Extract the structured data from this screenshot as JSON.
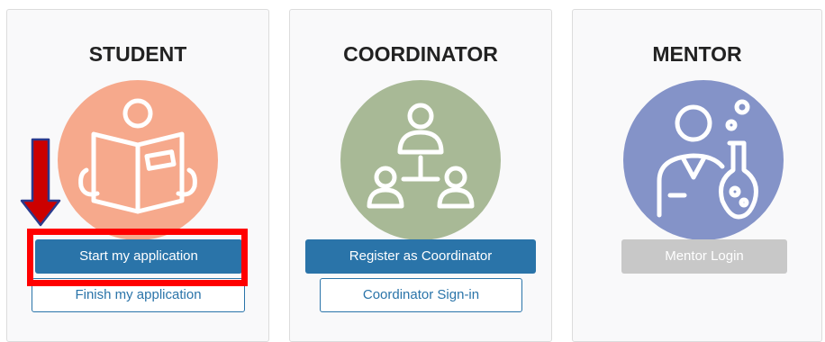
{
  "student": {
    "title": "STUDENT",
    "icon": "reading-book-icon",
    "circle_color": "#f6a98c",
    "primary_label": "Start my application",
    "secondary_label": "Finish my application"
  },
  "coordinator": {
    "title": "COORDINATOR",
    "icon": "org-hierarchy-icon",
    "circle_color": "#a8b996",
    "primary_label": "Register as Coordinator",
    "secondary_label": "Coordinator Sign-in"
  },
  "mentor": {
    "title": "MENTOR",
    "icon": "scientist-flask-icon",
    "circle_color": "#8493c8",
    "primary_label": "Mentor Login"
  },
  "colors": {
    "primary_button": "#2a74a9",
    "disabled_button": "#c8c8c8",
    "highlight": "#ff0000",
    "arrow": "#cc0000"
  }
}
